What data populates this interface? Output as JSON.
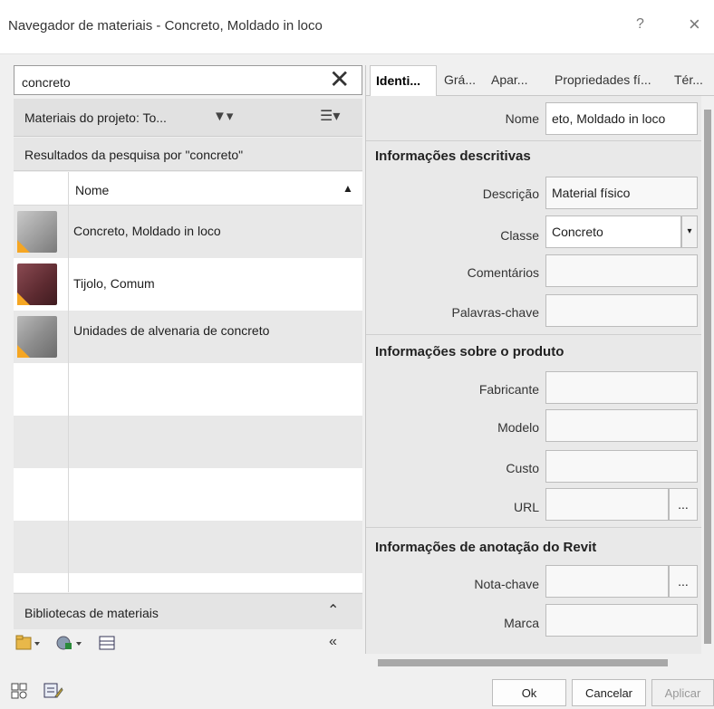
{
  "window": {
    "title": "Navegador de materiais - Concreto, Moldado in loco",
    "help": "?",
    "close": "×"
  },
  "left": {
    "search_value": "concreto",
    "clear_icon": "✕",
    "project_label": "Materiais do projeto: To...",
    "filter_icon": "▼▾",
    "view_icon": "☰▾",
    "results_label": "Resultados da pesquisa por \"concreto\"",
    "column_name": "Nome",
    "sort_icon": "▲",
    "rows": [
      {
        "name": "Concreto, Moldado in loco",
        "thumb": "concrete"
      },
      {
        "name": "Tijolo, Comum",
        "thumb": "brick"
      },
      {
        "name": "Unidades de alvenaria de concreto",
        "thumb": "block"
      }
    ],
    "library_label": "Bibliotecas de materiais",
    "library_chevron": "⌃",
    "collapse_icon": "«"
  },
  "right": {
    "tabs": [
      "Identi...",
      "Grá...",
      "Apar...",
      "Propriedades fí...",
      "Tér..."
    ],
    "name_label": "Nome",
    "name_value": "eto, Moldado in loco",
    "sec_desc": "Informações descritivas",
    "descricao_label": "Descrição",
    "descricao_value": "Material físico",
    "classe_label": "Classe",
    "classe_value": "Concreto",
    "comentarios_label": "Comentários",
    "palavras_label": "Palavras-chave",
    "sec_prod": "Informações sobre o produto",
    "fabricante_label": "Fabricante",
    "modelo_label": "Modelo",
    "custo_label": "Custo",
    "url_label": "URL",
    "ellipsis": "...",
    "sec_revit": "Informações de anotação do Revit",
    "nota_label": "Nota-chave",
    "marca_label": "Marca"
  },
  "footer": {
    "ok": "Ok",
    "cancel": "Cancelar",
    "apply": "Aplicar"
  }
}
